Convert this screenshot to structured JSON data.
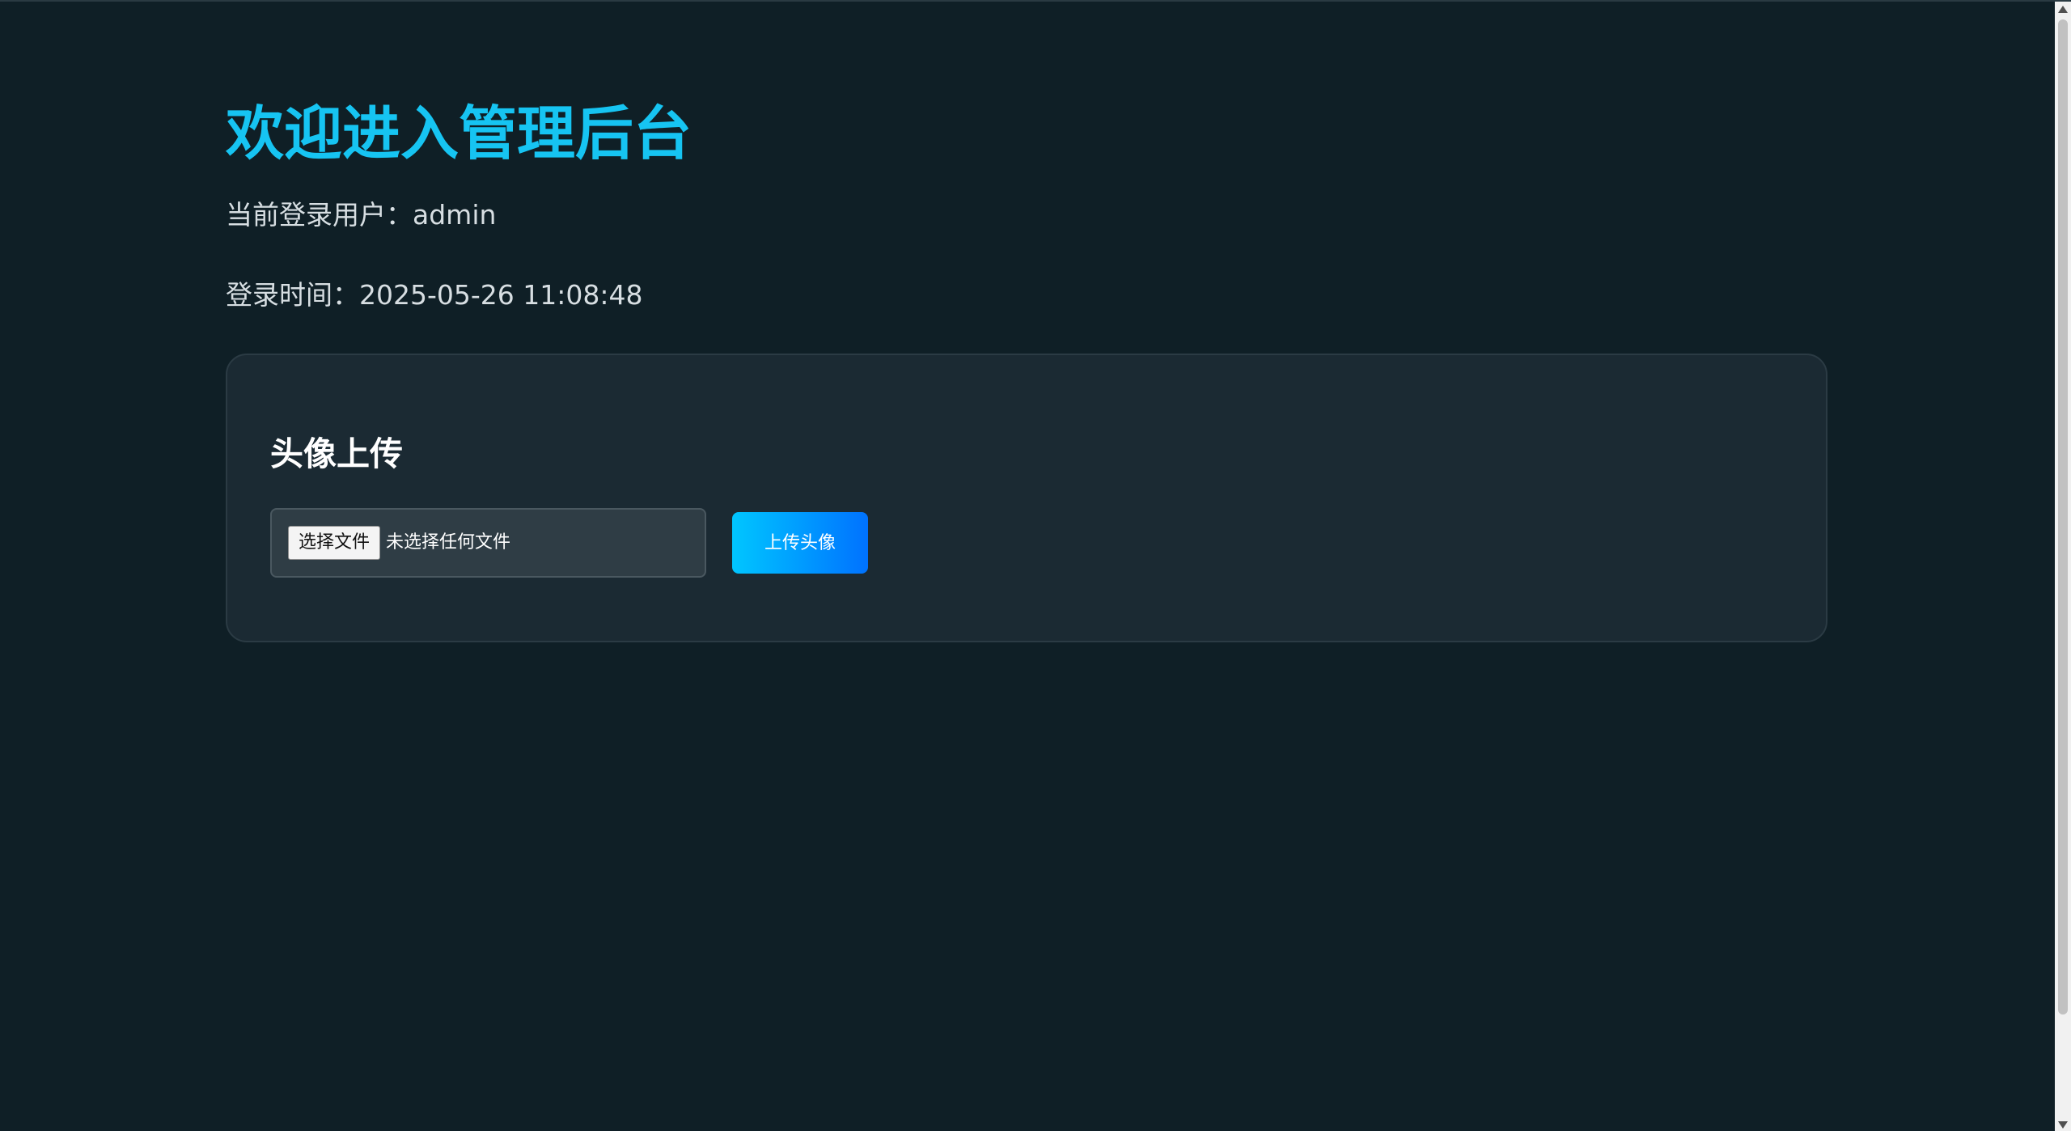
{
  "header": {
    "title": "欢迎进入管理后台",
    "current_user_text": "当前登录用户：admin",
    "login_time_text": "登录时间：2025-05-26 11:08:48"
  },
  "avatar_upload": {
    "title": "头像上传",
    "choose_file_label": "选择文件",
    "file_status": "未选择任何文件",
    "upload_button_label": "上传头像"
  },
  "colors": {
    "background": "#0f1f26",
    "card_background": "#1b2a33",
    "title_accent": "#16c4f2",
    "button_gradient_start": "#00c6ff",
    "button_gradient_end": "#0072ff"
  },
  "icons": {
    "scroll_up": "triangle-up",
    "scroll_down": "triangle-down"
  }
}
